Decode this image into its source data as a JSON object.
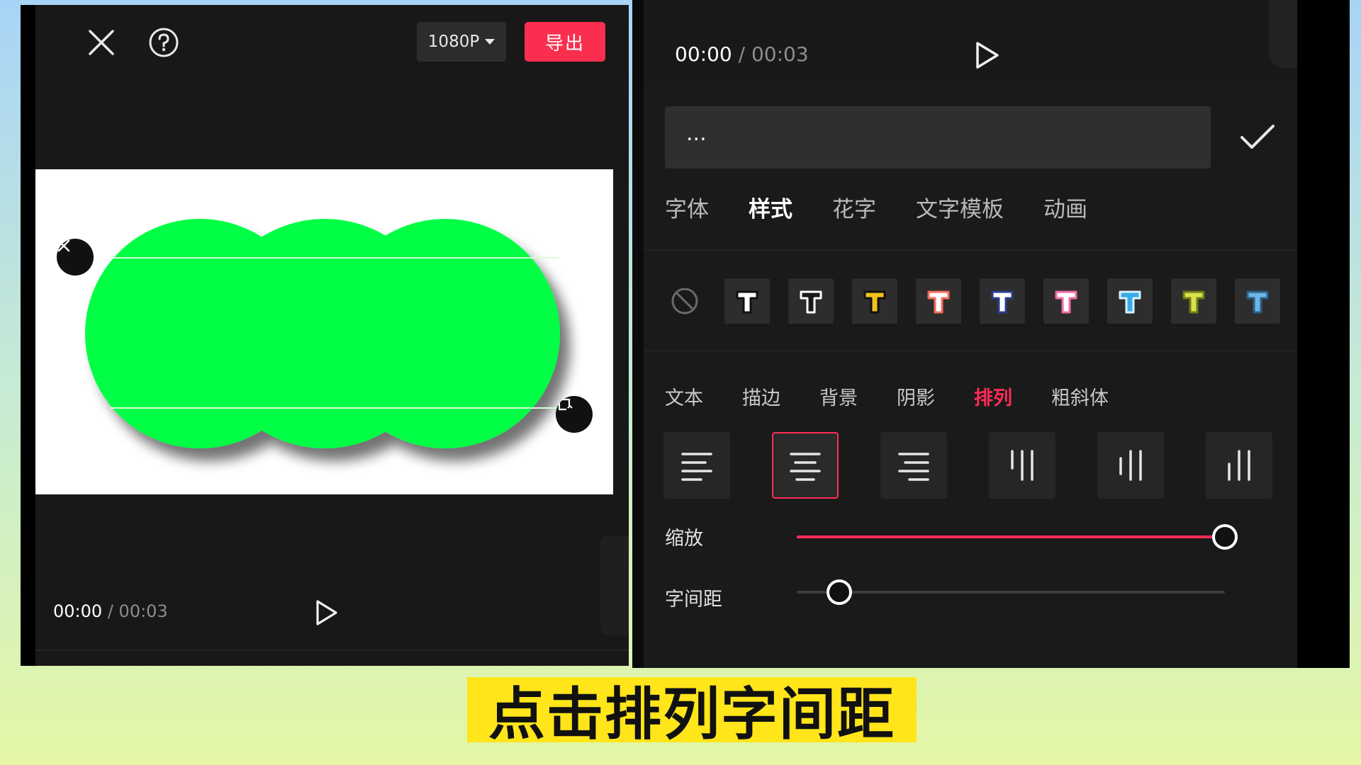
{
  "left_screen": {
    "resolution_label": "1080P",
    "export_label": "导出",
    "current_time": "00:00",
    "separator": "/",
    "total_time": "00:03"
  },
  "right_screen": {
    "current_time": "00:00",
    "separator": "/",
    "total_time": "00:03",
    "text_input_value": "...",
    "tabs": [
      {
        "label": "字体"
      },
      {
        "label": "样式"
      },
      {
        "label": "花字"
      },
      {
        "label": "文字模板"
      },
      {
        "label": "动画"
      }
    ],
    "active_tab": "样式",
    "style_presets": [
      {
        "fill": "#ffffff",
        "stroke": "#111111",
        "shadow": "#000000"
      },
      {
        "fill": "#1a1a1a",
        "stroke": "#ffffff",
        "shadow": "#000000"
      },
      {
        "fill": "#f2c21b",
        "stroke": "#111111",
        "shadow": "#000000"
      },
      {
        "fill": "#ffffff",
        "stroke": "#f26c5a",
        "shadow": "#000000"
      },
      {
        "fill": "#ffffff",
        "stroke": "#2a3e8f",
        "shadow": "#000000"
      },
      {
        "fill": "#ffffff",
        "stroke": "#f06aa5",
        "shadow": "#000000"
      },
      {
        "fill": "#3aa9e8",
        "stroke": "#d8f2ff",
        "shadow": "#000000"
      },
      {
        "fill": "#d8e04a",
        "stroke": "#6c7a1a",
        "shadow": "#000000"
      },
      {
        "fill": "#6bb6e5",
        "stroke": "#2c5f85",
        "shadow": "#000000"
      }
    ],
    "sub_tabs": [
      {
        "label": "文本"
      },
      {
        "label": "描边"
      },
      {
        "label": "背景"
      },
      {
        "label": "阴影"
      },
      {
        "label": "排列"
      },
      {
        "label": "粗斜体"
      }
    ],
    "active_sub_tab": "排列",
    "alignment_options": [
      {
        "name": "align-left-horizontal-icon",
        "selected": false
      },
      {
        "name": "align-center-horizontal-icon",
        "selected": true
      },
      {
        "name": "align-right-horizontal-icon",
        "selected": false
      },
      {
        "name": "align-top-vertical-icon",
        "selected": false
      },
      {
        "name": "align-middle-vertical-icon",
        "selected": false
      },
      {
        "name": "align-bottom-vertical-icon",
        "selected": false
      }
    ],
    "scale_label": "缩放",
    "scale_value": 1.0,
    "spacing_label": "字间距",
    "spacing_value": 0.1
  },
  "caption": "点击排列字间距",
  "colors": {
    "accent": "#fe2c55",
    "export_bg": "#fa2e4e",
    "shape_green": "#00ff44",
    "caption_bg": "#ffe51a"
  }
}
